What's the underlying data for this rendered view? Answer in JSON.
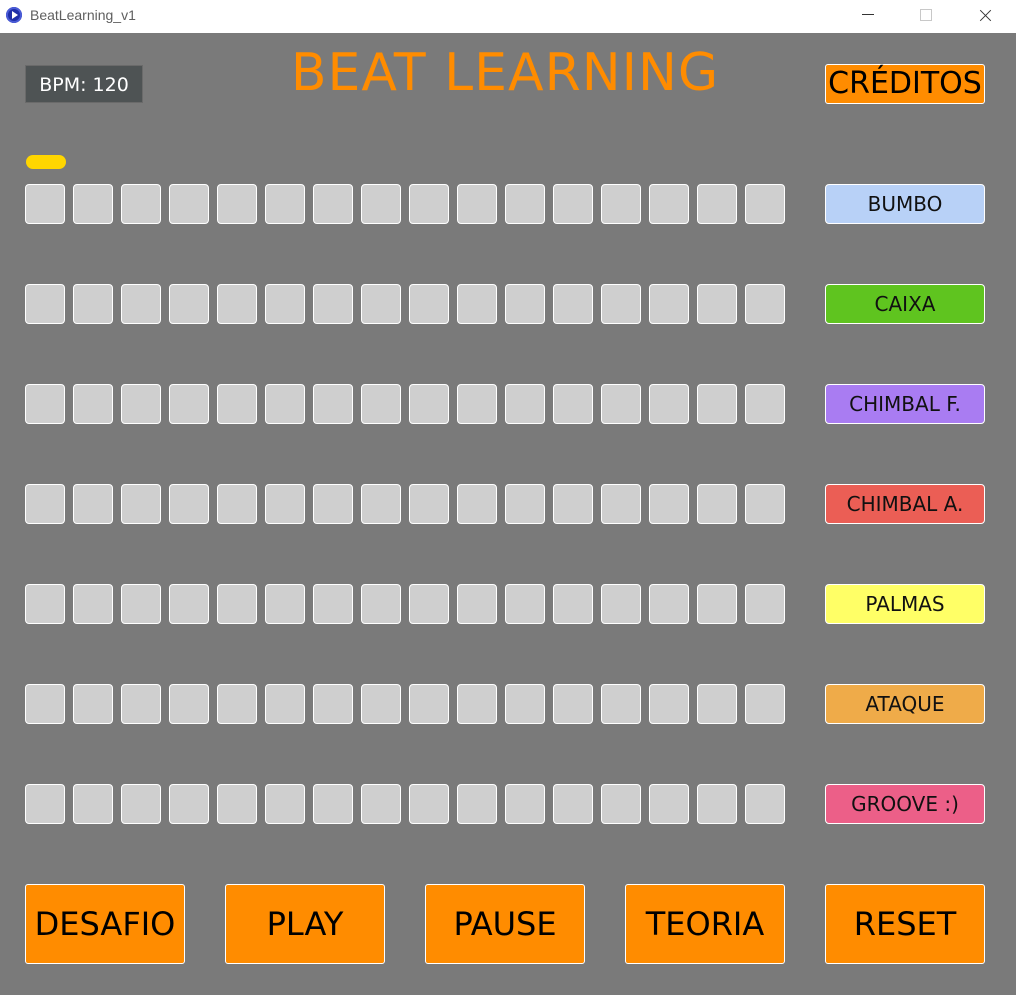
{
  "window": {
    "title": "BeatLearning_v1"
  },
  "header": {
    "bpm_label": "BPM: 120",
    "title": "BEAT LEARNING",
    "credits_label": "CRÉDITOS"
  },
  "sequencer": {
    "steps_per_row": 16,
    "current_step": 1,
    "rows": [
      {
        "label": "BUMBO",
        "color": "#b8d1f7"
      },
      {
        "label": "CAIXA",
        "color": "#5fc41f"
      },
      {
        "label": "CHIMBAL F.",
        "color": "#a97cf2"
      },
      {
        "label": "CHIMBAL A.",
        "color": "#eb5e55"
      },
      {
        "label": "PALMAS",
        "color": "#ffff66"
      },
      {
        "label": "ATAQUE",
        "color": "#efab49"
      },
      {
        "label": "GROOVE :)",
        "color": "#ec5f88"
      }
    ]
  },
  "controls": {
    "desafio": "DESAFIO",
    "play": "PLAY",
    "pause": "PAUSE",
    "teoria": "TEORIA",
    "reset": "RESET"
  },
  "colors": {
    "background": "#7a7a7a",
    "accent": "#ff8c00",
    "step_off": "#cfcfcf",
    "playhead": "#ffd600"
  }
}
